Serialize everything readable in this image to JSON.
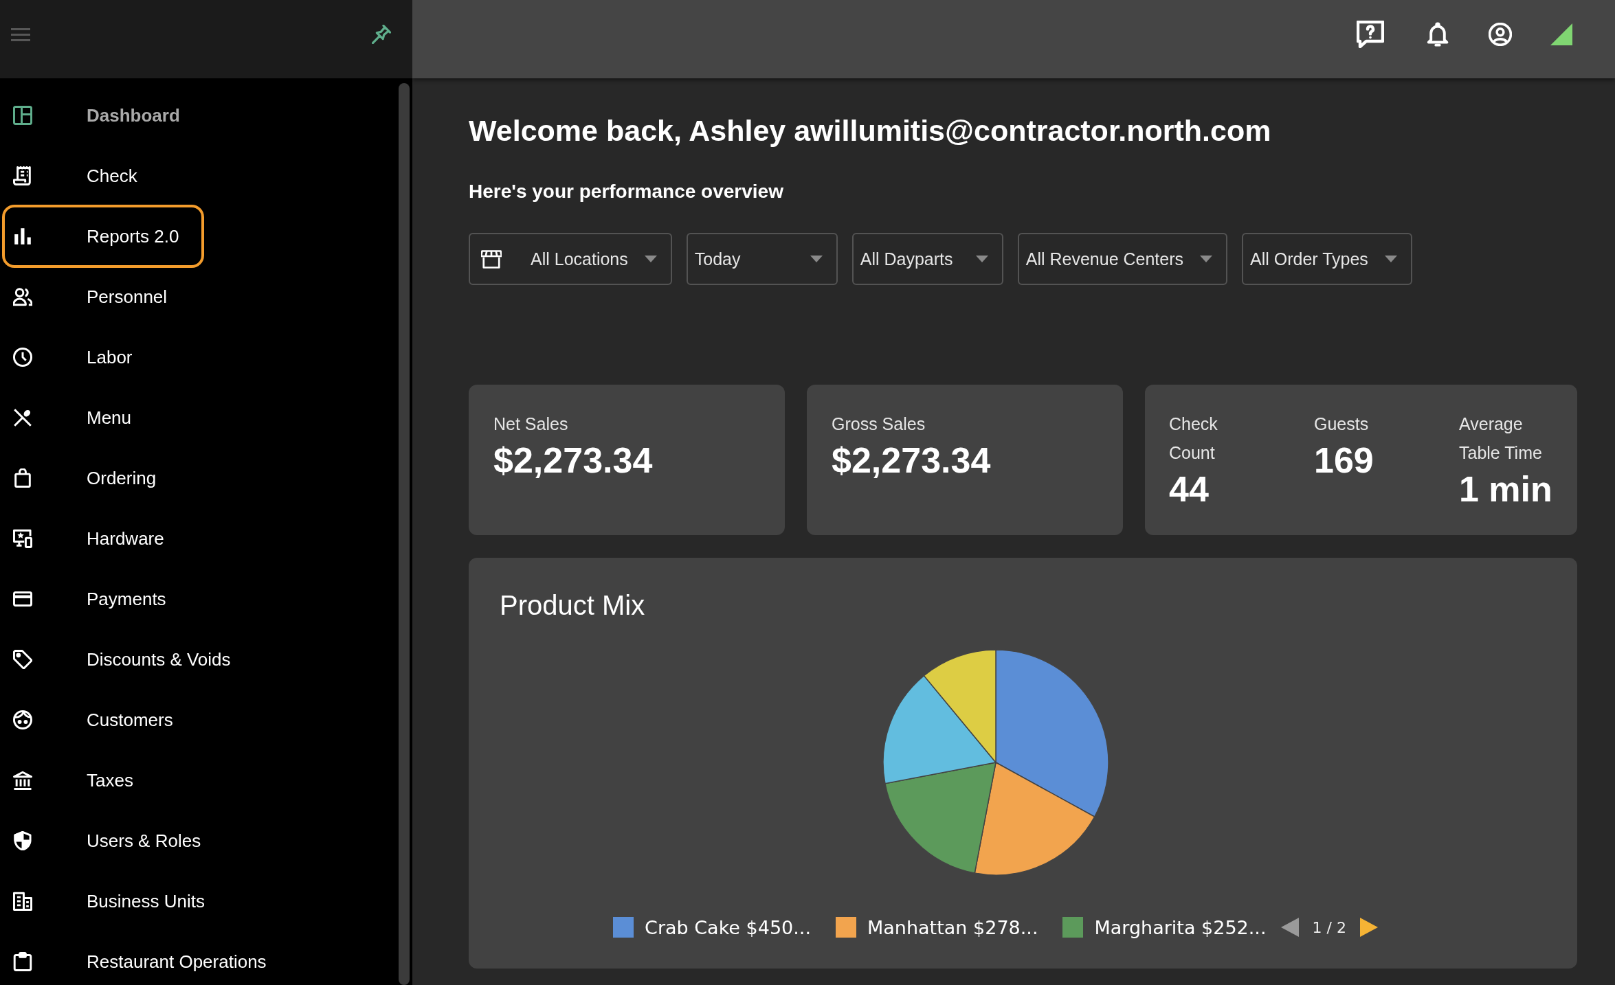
{
  "sidebar": {
    "items": [
      {
        "label": "Dashboard",
        "selected": true,
        "focused": false
      },
      {
        "label": "Check",
        "selected": false,
        "focused": false
      },
      {
        "label": "Reports 2.0",
        "selected": false,
        "focused": true
      },
      {
        "label": "Personnel",
        "selected": false,
        "focused": false
      },
      {
        "label": "Labor",
        "selected": false,
        "focused": false
      },
      {
        "label": "Menu",
        "selected": false,
        "focused": false
      },
      {
        "label": "Ordering",
        "selected": false,
        "focused": false
      },
      {
        "label": "Hardware",
        "selected": false,
        "focused": false
      },
      {
        "label": "Payments",
        "selected": false,
        "focused": false
      },
      {
        "label": "Discounts & Voids",
        "selected": false,
        "focused": false
      },
      {
        "label": "Customers",
        "selected": false,
        "focused": false
      },
      {
        "label": "Taxes",
        "selected": false,
        "focused": false
      },
      {
        "label": "Users & Roles",
        "selected": false,
        "focused": false
      },
      {
        "label": "Business Units",
        "selected": false,
        "focused": false
      },
      {
        "label": "Restaurant Operations",
        "selected": false,
        "focused": false
      }
    ]
  },
  "main": {
    "title": "Welcome back, Ashley awillumitis@contractor.north.com",
    "subtitle": "Here's your performance overview",
    "filters": [
      {
        "kind": "location",
        "value": "All Locations"
      },
      {
        "kind": "select",
        "value": "Today"
      },
      {
        "kind": "select",
        "value": "All Dayparts"
      },
      {
        "kind": "select",
        "value": "All Revenue Centers"
      },
      {
        "kind": "select",
        "value": "All Order Types"
      }
    ],
    "cards": [
      {
        "stats": [
          {
            "label": "Net Sales",
            "value": "$2,273.34"
          }
        ]
      },
      {
        "stats": [
          {
            "label": "Gross Sales",
            "value": "$2,273.34"
          }
        ]
      },
      {
        "stats": [
          {
            "label": "Check Count",
            "value": "44"
          },
          {
            "label": "Guests",
            "value": "169"
          },
          {
            "label": "Average Table Time",
            "value": "1 min"
          }
        ]
      }
    ],
    "product_mix": {
      "title": "Product Mix",
      "chart_data": {
        "type": "pie",
        "values": [
          33,
          20,
          19,
          17,
          11
        ],
        "colors": [
          "#5b8ed6",
          "#f2a44e",
          "#5c9a5b",
          "#62bddf",
          "#ddcd44"
        ]
      },
      "legend": {
        "items": [
          {
            "label": "Crab Cake $450...",
            "color": "#5b8ed6"
          },
          {
            "label": "Manhattan $278...",
            "color": "#f2a44e"
          },
          {
            "label": "Margharita $252...",
            "color": "#5c9a5b"
          }
        ],
        "pager": {
          "text": "1 / 2",
          "prev_disabled": true,
          "next_disabled": false
        }
      }
    }
  }
}
